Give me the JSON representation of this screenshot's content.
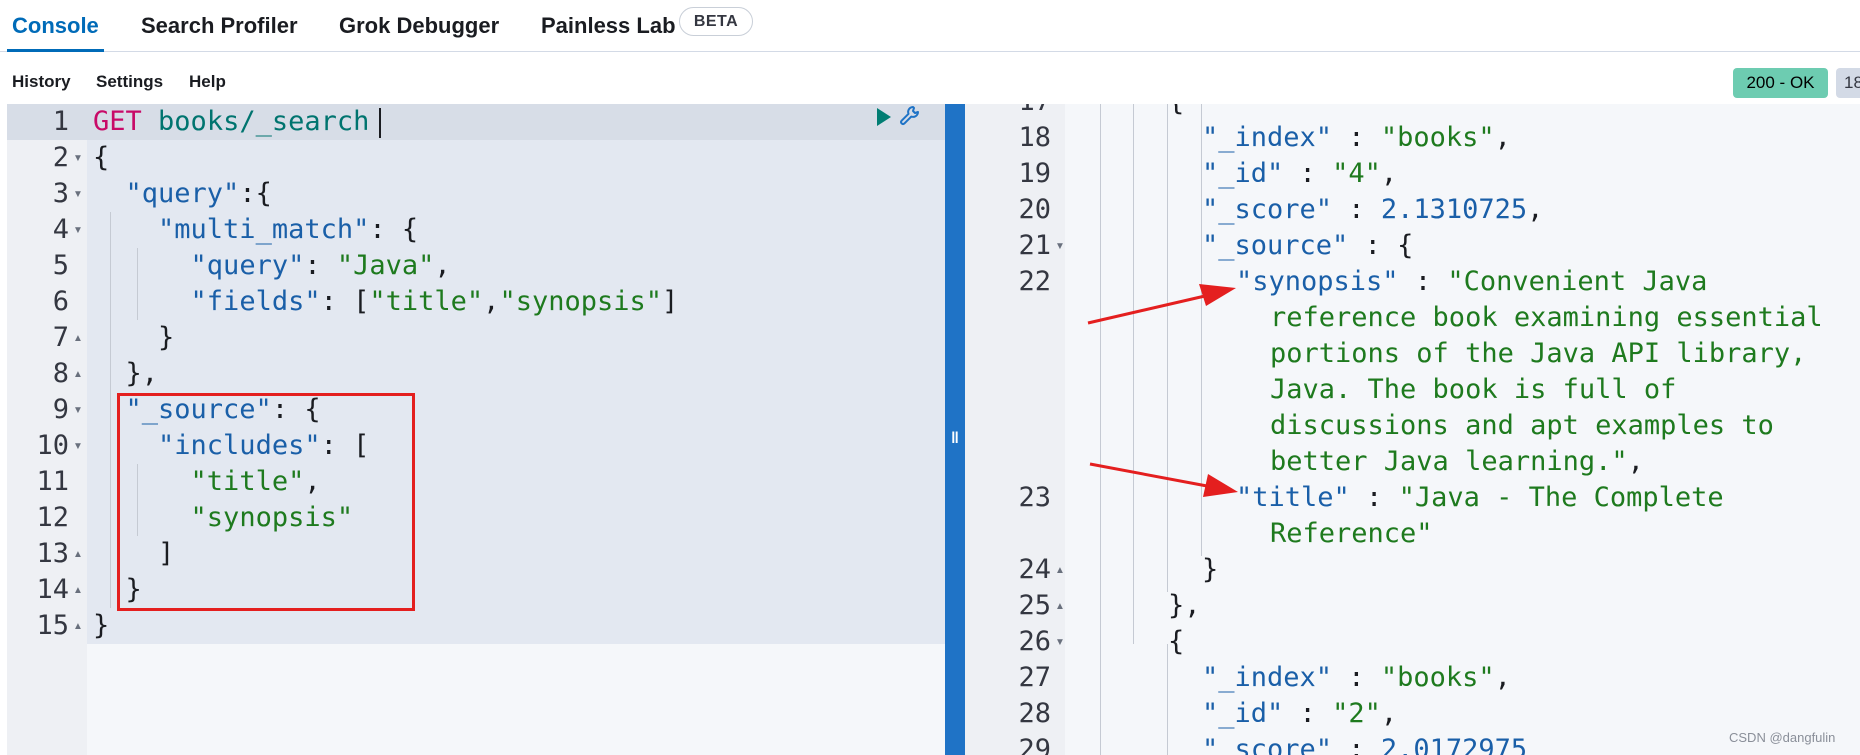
{
  "tabs": [
    {
      "label": "Console",
      "active": true
    },
    {
      "label": "Search Profiler",
      "active": false
    },
    {
      "label": "Grok Debugger",
      "active": false
    },
    {
      "label": "Painless Lab",
      "active": false
    }
  ],
  "beta_badge": "BETA",
  "menu": {
    "history": "History",
    "settings": "Settings",
    "help": "Help"
  },
  "status": {
    "code": "200 - OK",
    "time": "18"
  },
  "request": {
    "line_numbers": [
      "1",
      "2",
      "3",
      "4",
      "5",
      "6",
      "7",
      "8",
      "9",
      "10",
      "11",
      "12",
      "13",
      "14",
      "15"
    ],
    "method": "GET",
    "path": "books/_search",
    "lines": {
      "l2": "{",
      "l3_key": "\"query\"",
      "l3_rest": ":{",
      "l4_key": "\"multi_match\"",
      "l4_rest": ": {",
      "l5_key": "\"query\"",
      "l5_mid": ": ",
      "l5_val": "\"Java\"",
      "l5_end": ",",
      "l6_key": "\"fields\"",
      "l6_mid": ": [",
      "l6_v1": "\"title\"",
      "l6_comma": ",",
      "l6_v2": "\"synopsis\"",
      "l6_end": "]",
      "l7": "}",
      "l8": "},",
      "l9_key": "\"_source\"",
      "l9_rest": ": {",
      "l10_key": "\"includes\"",
      "l10_rest": ": [",
      "l11_val": "\"title\"",
      "l11_end": ",",
      "l12_val": "\"synopsis\"",
      "l13": "]",
      "l14": "}",
      "l15": "}"
    }
  },
  "response": {
    "line_numbers": {
      "n17": "17",
      "n18": "18",
      "n19": "19",
      "n20": "20",
      "n21": "21",
      "n22": "22",
      "n23": "23",
      "n24": "24",
      "n25": "25",
      "n26": "26",
      "n27": "27",
      "n28": "28",
      "n29": "29"
    },
    "lines": {
      "r17": "{",
      "r18_key": "\"_index\"",
      "r18_sep": " : ",
      "r18_val": "\"books\"",
      "r18_end": ",",
      "r19_key": "\"_id\"",
      "r19_sep": " : ",
      "r19_val": "\"4\"",
      "r19_end": ",",
      "r20_key": "\"_score\"",
      "r20_sep": " : ",
      "r20_val": "2.1310725",
      "r20_end": ",",
      "r21_key": "\"_source\"",
      "r21_rest": " : {",
      "r22_key": "\"synopsis\"",
      "r22_sep": " : ",
      "r22_val1": "\"Convenient Java",
      "r22_val2": "reference book examining essential",
      "r22_val3": "portions of the Java API library,",
      "r22_val4": "Java. The book is full of",
      "r22_val5": "discussions and apt examples to",
      "r22_val6": "better Java learning.\"",
      "r22_end": ",",
      "r23_key": "\"title\"",
      "r23_sep": " : ",
      "r23_val1": "\"Java - The Complete",
      "r23_val2": "Reference\"",
      "r24": "}",
      "r25": "},",
      "r26": "{",
      "r27_key": "\"_index\"",
      "r27_sep": " : ",
      "r27_val": "\"books\"",
      "r27_end": ",",
      "r28_key": "\"_id\"",
      "r28_sep": " : ",
      "r28_val": "\"2\"",
      "r28_end": ",",
      "r29_key": "\"_score\"",
      "r29_sep": " : ",
      "r29_val": "2.0172975"
    }
  },
  "watermark": "CSDN @dangfulin",
  "colors": {
    "accent": "#006bb8",
    "status_ok": "#6dccb1",
    "annotation": "#e41f1f",
    "divider": "#1f73c6"
  }
}
